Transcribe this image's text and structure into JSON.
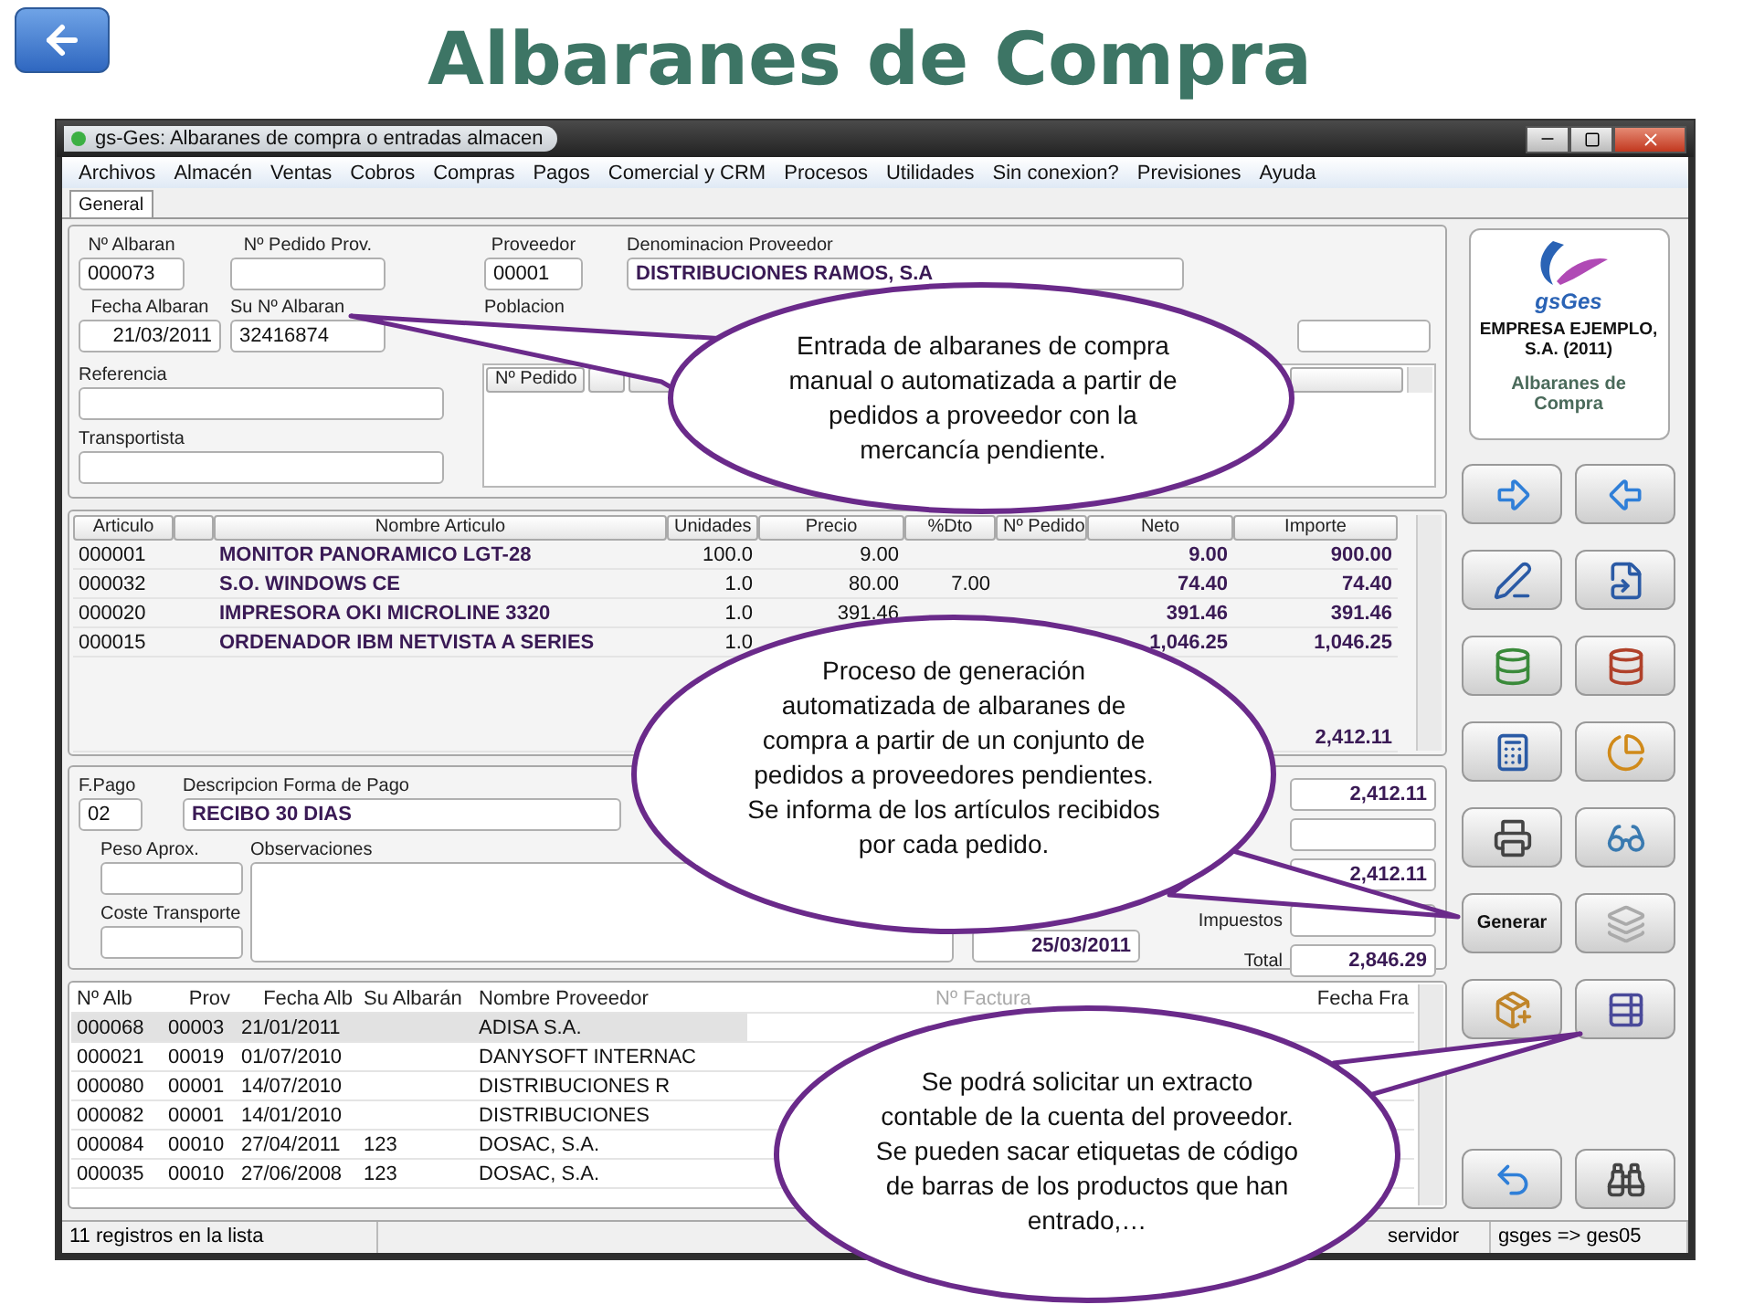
{
  "slide": {
    "title": "Albaranes de Compra"
  },
  "window": {
    "title": "gs-Ges: Albaranes de compra o entradas almacen"
  },
  "menu": [
    "Archivos",
    "Almacén",
    "Ventas",
    "Cobros",
    "Compras",
    "Pagos",
    "Comercial y CRM",
    "Procesos",
    "Utilidades",
    "Sin conexion?",
    "Previsiones",
    "Ayuda"
  ],
  "tabs": [
    {
      "label": "General",
      "selected": true
    }
  ],
  "header": {
    "n_albaran": {
      "label": "Nº Albaran",
      "value": "000073"
    },
    "pedido_prov": {
      "label": "Nº Pedido Prov."
    },
    "proveedor": {
      "label": "Proveedor",
      "value": "00001"
    },
    "denominacion": {
      "label": "Denominacion Proveedor",
      "value": "DISTRIBUCIONES RAMOS, S.A"
    },
    "fecha": {
      "label": "Fecha Albaran",
      "value": "21/03/2011"
    },
    "su_albaran": {
      "label": "Su Nº Albaran",
      "value": "32416874"
    },
    "poblacion": {
      "label": "Poblacion"
    },
    "referencia": {
      "label": "Referencia"
    },
    "transportista": {
      "label": "Transportista"
    }
  },
  "pedidos_grid": {
    "columns": [
      "Nº Pedido"
    ]
  },
  "lines": {
    "columns": [
      "Articulo",
      "Nombre Articulo",
      "Unidades",
      "Precio",
      "%Dto",
      "Nº Pedido",
      "Neto",
      "Importe"
    ],
    "rows": [
      {
        "articulo": "000001",
        "nombre": "MONITOR PANORAMICO LGT-28",
        "unidades": "100.0",
        "precio": "9.00",
        "neto": "9.00",
        "importe": "900.00"
      },
      {
        "articulo": "000032",
        "nombre": "S.O. WINDOWS CE",
        "unidades": "1.0",
        "precio": "80.00",
        "dto": "7.00",
        "neto": "74.40",
        "importe": "74.40"
      },
      {
        "articulo": "000020",
        "nombre": "IMPRESORA OKI MICROLINE 3320",
        "unidades": "1.0",
        "precio": "391.46",
        "neto": "391.46",
        "importe": "391.46"
      },
      {
        "articulo": "000015",
        "nombre": "ORDENADOR IBM NETVISTA A SERIES",
        "unidades": "1.0",
        "neto": "1,046.25",
        "importe": "1,046.25"
      }
    ],
    "total_importe": "2,412.11"
  },
  "payment": {
    "f_pago": {
      "label": "F.Pago",
      "value": "02"
    },
    "descripcion": {
      "label": "Descripcion Forma de Pago",
      "value": "RECIBO 30 DIAS"
    },
    "peso": {
      "label": "Peso Aprox."
    },
    "observaciones": {
      "label": "Observaciones"
    },
    "coste": {
      "label": "Coste Transporte"
    },
    "fecha_factura": "25/03/2011"
  },
  "totals": {
    "bruto": "2,412.11",
    "neto": "2,412.11",
    "impuestos_label": "Impuestos",
    "total_label": "Total",
    "total": "2,846.29"
  },
  "list": {
    "columns": [
      "Nº Alb",
      "Prov",
      "Fecha Alb",
      "Su Albarán",
      "Nombre Proveedor",
      "Nº Factura",
      "Fecha Fra"
    ],
    "rows": [
      {
        "cells": [
          "000068",
          "00003",
          "21/01/2011",
          "",
          "ADISA S.A."
        ],
        "selected": true
      },
      {
        "cells": [
          "000021",
          "00019",
          "01/07/2010",
          "",
          "DANYSOFT INTERNAC"
        ],
        "selected": false
      },
      {
        "cells": [
          "000080",
          "00001",
          "14/07/2010",
          "",
          "DISTRIBUCIONES R"
        ],
        "selected": false
      },
      {
        "cells": [
          "000082",
          "00001",
          "14/01/2010",
          "",
          "DISTRIBUCIONES"
        ],
        "selected": false
      },
      {
        "cells": [
          "000084",
          "00010",
          "27/04/2011",
          "123",
          "DOSAC, S.A."
        ],
        "selected": false
      },
      {
        "cells": [
          "000035",
          "00010",
          "27/06/2008",
          "123",
          "DOSAC, S.A."
        ],
        "selected": false
      }
    ]
  },
  "status_bar": [
    "11 registros en la lista",
    "servidor",
    "gsges => ges05"
  ],
  "logo_card": {
    "brand": "gsGes",
    "company": "EMPRESA EJEMPLO, S.A. (2011)",
    "module": "Albaranes de Compra"
  },
  "toolbar": [
    {
      "kind": "icon"
    },
    {
      "kind": "icon"
    },
    {
      "kind": "icon"
    },
    {
      "kind": "icon"
    },
    {
      "kind": "icon"
    },
    {
      "kind": "icon"
    },
    {
      "kind": "icon"
    },
    {
      "kind": "icon"
    },
    {
      "kind": "icon"
    },
    {
      "kind": "icon"
    },
    {
      "kind": "label",
      "label": "Generar"
    },
    {
      "kind": "icon"
    },
    {
      "kind": "icon"
    },
    {
      "kind": "icon"
    },
    {
      "kind": "icon"
    },
    {
      "kind": "icon"
    }
  ],
  "callouts": [
    "Entrada de albaranes de compra manual o automatizada a partir de pedidos a proveedor con la mercancía pendiente.",
    "Proceso de generación automatizada de albaranes de compra a partir de un conjunto de pedidos a proveedores pendientes. Se informa de los artículos recibidos por cada pedido.",
    "Se podrá solicitar un extracto contable de la cuenta del proveedor. Se pueden sacar etiquetas de código de barras de los productos que han entrado,…"
  ]
}
